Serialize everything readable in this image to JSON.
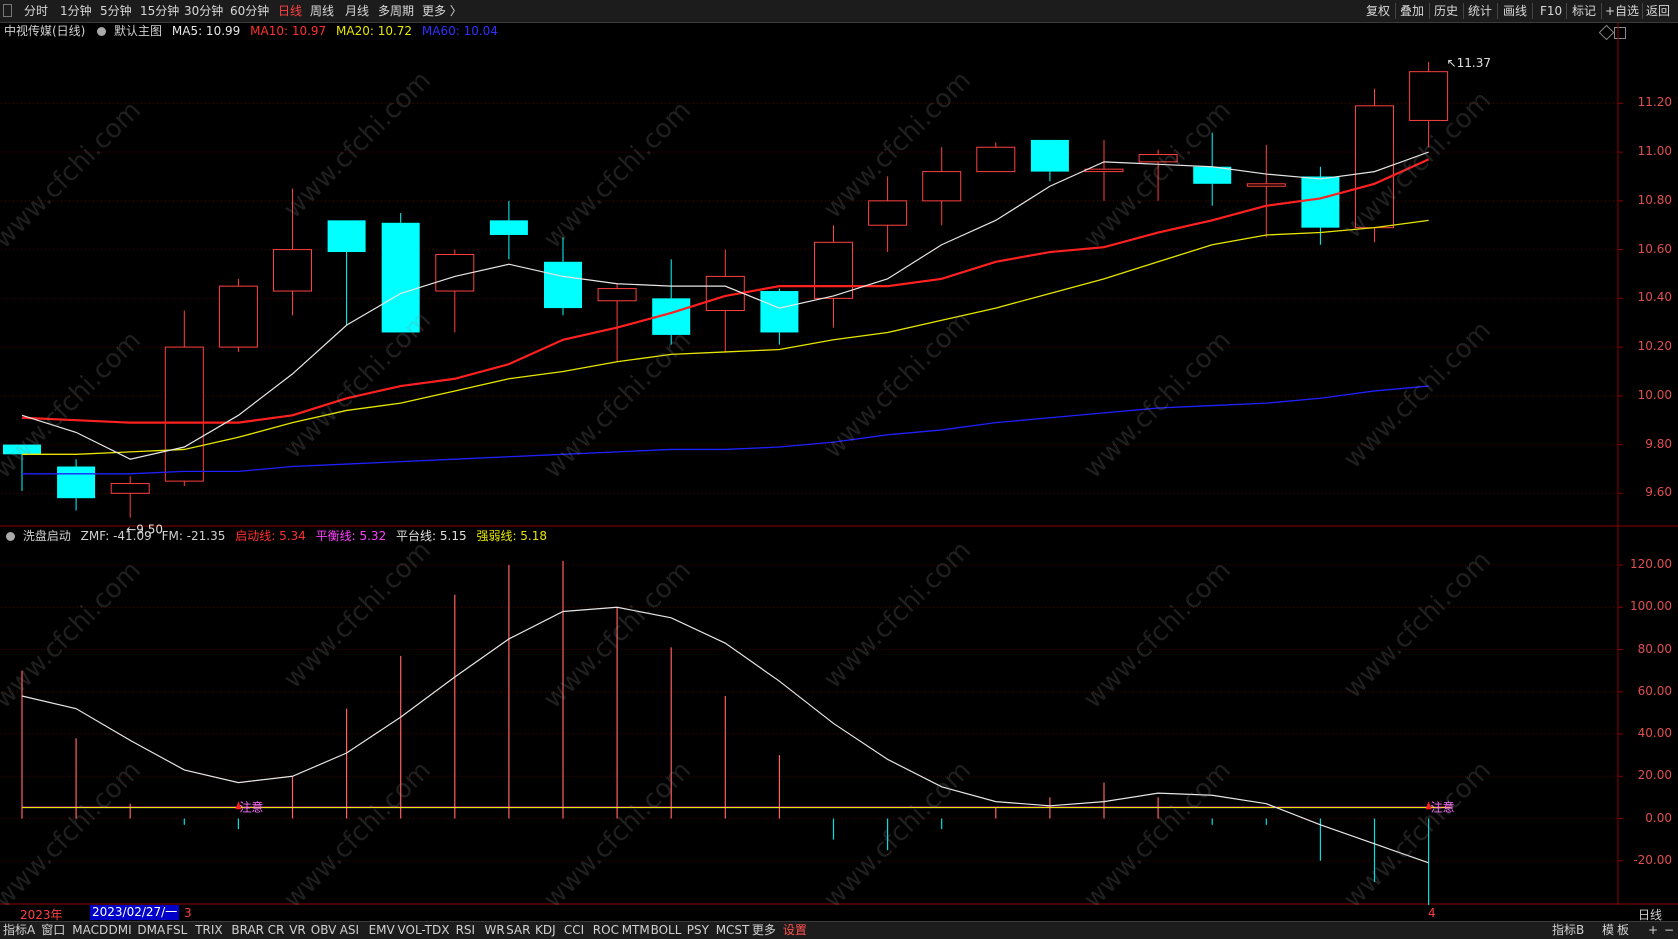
{
  "topbar": {
    "left_tabs": [
      "分时",
      "1分钟",
      "5分钟",
      "15分钟",
      "30分钟",
      "60分钟",
      "日线",
      "周线",
      "月线",
      "多周期",
      "更多 〉"
    ],
    "active_tab": "日线",
    "right_buttons": [
      "复权",
      "叠加",
      "历史",
      "统计",
      "画线",
      "F10",
      "标记",
      "+自选",
      "返回"
    ]
  },
  "main": {
    "stock_name": "中视传媒(日线)",
    "chart_name": "默认主图",
    "ma5": "MA5: 10.99",
    "ma10": "MA10: 10.97",
    "ma20": "MA20: 10.72",
    "ma60": "MA60: 10.04",
    "high_label": "11.37",
    "low_label": "9.50"
  },
  "indicator": {
    "name": "洗盘启动",
    "zmf": "ZMF: -41.09",
    "fm": "FM: -21.35",
    "qidong": "启动线: 5.34",
    "pingheng": "平衡线: 5.32",
    "pingtai": "平台线: 5.15",
    "qiangruo": "强弱线: 5.18",
    "note1": "注意",
    "note2": "注意"
  },
  "axes": {
    "price_ticks": [
      "11.20",
      "11.00",
      "10.80",
      "10.60",
      "10.40",
      "10.20",
      "10.00",
      "9.80",
      "9.60"
    ],
    "ind_ticks": [
      "120.00",
      "100.00",
      "80.00",
      "60.00",
      "40.00",
      "20.00",
      "0.00",
      "-20.00"
    ]
  },
  "datebar": {
    "year": "2023年",
    "cursor_date": "2023/02/27/一",
    "m3": "3",
    "m4": "4",
    "period": "日线"
  },
  "bottombar": {
    "items": [
      "指标A",
      "窗口",
      "MACD",
      "DMI",
      "DMA",
      "FSL",
      "TRIX",
      "BRAR",
      "CR",
      "VR",
      "OBV",
      "ASI",
      "EMV",
      "VOL-TDX",
      "RSI",
      "WR",
      "SAR",
      "KDJ",
      "CCI",
      "ROC",
      "MTM",
      "BOLL",
      "PSY",
      "MCST",
      "更多",
      "设置"
    ],
    "active_item": "设置",
    "right_items": [
      "指标B",
      "模",
      "板",
      "+",
      "−"
    ]
  },
  "colors": {
    "up": "#ff4040",
    "down": "#00ffff",
    "ma5": "#e6e6e6",
    "ma10": "#ff2020",
    "ma20": "#e6e600",
    "ma60": "#2020ff",
    "axis": "#e05050"
  },
  "chart_data": [
    {
      "type": "candlestick",
      "title": "中视传媒(日线)",
      "price_range": [
        9.5,
        11.37
      ],
      "candles": [
        {
          "o": 9.8,
          "c": 9.76,
          "h": 9.8,
          "l": 9.61
        },
        {
          "o": 9.71,
          "c": 9.58,
          "h": 9.74,
          "l": 9.53
        },
        {
          "o": 9.6,
          "c": 9.64,
          "h": 9.67,
          "l": 9.5
        },
        {
          "o": 9.65,
          "c": 10.2,
          "h": 10.35,
          "l": 9.63
        },
        {
          "o": 10.2,
          "c": 10.45,
          "h": 10.48,
          "l": 10.18
        },
        {
          "o": 10.43,
          "c": 10.6,
          "h": 10.85,
          "l": 10.33
        },
        {
          "o": 10.72,
          "c": 10.59,
          "h": 10.72,
          "l": 10.29
        },
        {
          "o": 10.71,
          "c": 10.26,
          "h": 10.75,
          "l": 10.26
        },
        {
          "o": 10.43,
          "c": 10.58,
          "h": 10.6,
          "l": 10.26
        },
        {
          "o": 10.72,
          "c": 10.66,
          "h": 10.8,
          "l": 10.56
        },
        {
          "o": 10.55,
          "c": 10.36,
          "h": 10.65,
          "l": 10.33
        },
        {
          "o": 10.39,
          "c": 10.44,
          "h": 10.46,
          "l": 10.14
        },
        {
          "o": 10.4,
          "c": 10.25,
          "h": 10.56,
          "l": 10.21
        },
        {
          "o": 10.35,
          "c": 10.49,
          "h": 10.6,
          "l": 10.18
        },
        {
          "o": 10.43,
          "c": 10.26,
          "h": 10.44,
          "l": 10.21
        },
        {
          "o": 10.4,
          "c": 10.63,
          "h": 10.7,
          "l": 10.28
        },
        {
          "o": 10.7,
          "c": 10.8,
          "h": 10.9,
          "l": 10.59
        },
        {
          "o": 10.8,
          "c": 10.92,
          "h": 11.02,
          "l": 10.7
        },
        {
          "o": 10.92,
          "c": 11.02,
          "h": 11.04,
          "l": 10.92
        },
        {
          "o": 11.05,
          "c": 10.92,
          "h": 11.05,
          "l": 10.88
        },
        {
          "o": 10.92,
          "c": 10.93,
          "h": 11.05,
          "l": 10.8
        },
        {
          "o": 10.96,
          "c": 10.99,
          "h": 11.01,
          "l": 10.8
        },
        {
          "o": 10.94,
          "c": 10.87,
          "h": 11.08,
          "l": 10.78
        },
        {
          "o": 10.86,
          "c": 10.87,
          "h": 11.03,
          "l": 10.65
        },
        {
          "o": 10.9,
          "c": 10.69,
          "h": 10.94,
          "l": 10.62
        },
        {
          "o": 10.69,
          "c": 11.19,
          "h": 11.26,
          "l": 10.63
        },
        {
          "o": 11.13,
          "c": 11.33,
          "h": 11.37,
          "l": 11.02
        }
      ],
      "ma5": [
        9.92,
        9.85,
        9.74,
        9.79,
        9.92,
        10.09,
        10.29,
        10.42,
        10.49,
        10.54,
        10.49,
        10.46,
        10.45,
        10.45,
        10.36,
        10.41,
        10.48,
        10.62,
        10.72,
        10.86,
        10.96,
        10.95,
        10.94,
        10.91,
        10.89,
        10.92,
        11.0
      ],
      "ma10": [
        9.91,
        9.9,
        9.89,
        9.89,
        9.89,
        9.92,
        9.99,
        10.04,
        10.07,
        10.13,
        10.23,
        10.28,
        10.34,
        10.41,
        10.45,
        10.45,
        10.45,
        10.48,
        10.55,
        10.59,
        10.61,
        10.67,
        10.72,
        10.78,
        10.81,
        10.87,
        10.97
      ],
      "ma20": [
        9.76,
        9.76,
        9.77,
        9.78,
        9.83,
        9.89,
        9.94,
        9.97,
        10.02,
        10.07,
        10.1,
        10.14,
        10.17,
        10.18,
        10.19,
        10.23,
        10.26,
        10.31,
        10.36,
        10.42,
        10.48,
        10.55,
        10.62,
        10.66,
        10.67,
        10.69,
        10.72
      ],
      "ma60": [
        9.68,
        9.68,
        9.68,
        9.69,
        9.69,
        9.71,
        9.72,
        9.73,
        9.74,
        9.75,
        9.76,
        9.77,
        9.78,
        9.78,
        9.79,
        9.81,
        9.84,
        9.86,
        9.89,
        9.91,
        9.93,
        9.95,
        9.96,
        9.97,
        9.99,
        10.02,
        10.04
      ]
    },
    {
      "type": "bar",
      "title": "洗盘启动",
      "ylim": [
        -40,
        120
      ],
      "zmf_bars": [
        70,
        38,
        7,
        -3,
        -5,
        20,
        52,
        77,
        106,
        120,
        122,
        100,
        81,
        58,
        30,
        -10,
        -15,
        -5,
        5,
        10,
        17,
        10,
        -3,
        -3,
        -20,
        -30,
        -41
      ],
      "fm_line": [
        58,
        52,
        37,
        23,
        17,
        20,
        31,
        48,
        67,
        85,
        98,
        100,
        95,
        83,
        65,
        45,
        28,
        15,
        8,
        6,
        8,
        12,
        11,
        7,
        -3,
        -12,
        -21
      ],
      "flat_lines": [
        5.34,
        5.32,
        5.15,
        5.18
      ]
    }
  ]
}
